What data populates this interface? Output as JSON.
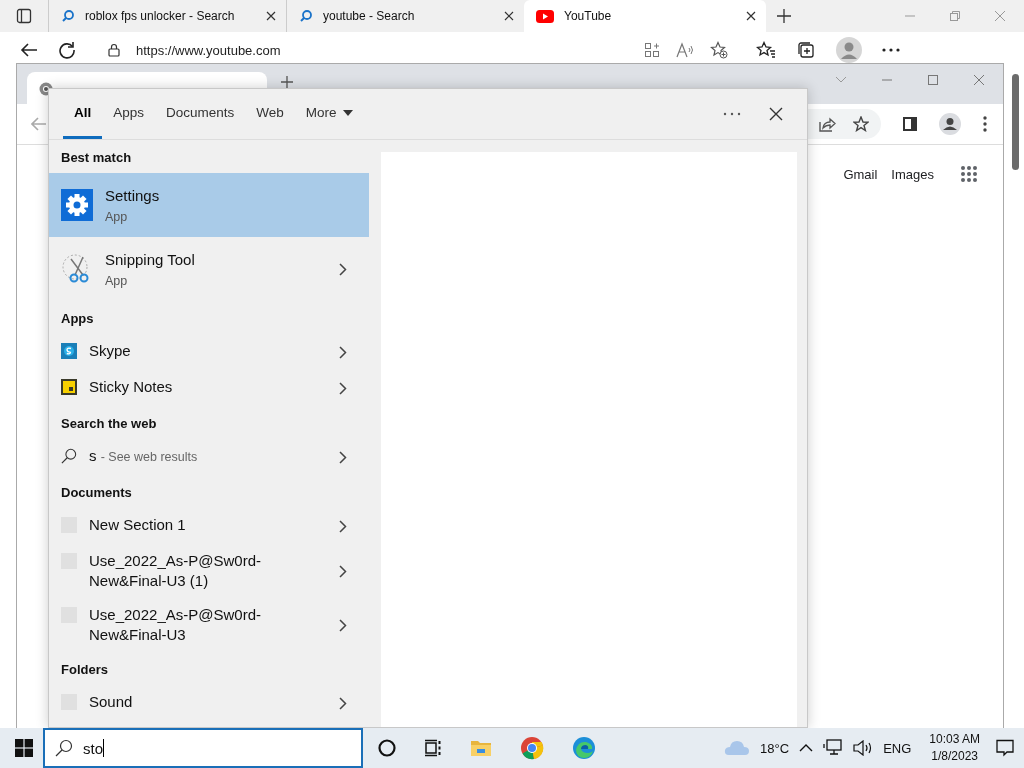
{
  "edge": {
    "tabs": [
      {
        "title": "roblox fps unlocker - Search",
        "kind": "search",
        "selected": false
      },
      {
        "title": "youtube - Search",
        "kind": "search",
        "selected": false
      },
      {
        "title": "YouTube",
        "kind": "youtube",
        "selected": true
      }
    ],
    "address": "https://www.youtube.com"
  },
  "chrome": {
    "links": [
      "Gmail",
      "Images"
    ]
  },
  "search": {
    "tabs": [
      {
        "label": "All",
        "selected": true
      },
      {
        "label": "Apps",
        "selected": false
      },
      {
        "label": "Documents",
        "selected": false
      },
      {
        "label": "Web",
        "selected": false
      },
      {
        "label": "More",
        "selected": false
      }
    ],
    "groups": [
      {
        "heading": "Best match",
        "items": [
          {
            "kind": "settings",
            "title": "Settings",
            "subtitle": "App",
            "selected": true
          },
          {
            "kind": "snipping",
            "title": "Snipping Tool",
            "subtitle": "App",
            "selected": false
          }
        ]
      },
      {
        "heading": "Apps",
        "items": [
          {
            "kind": "skype",
            "title": "Skype",
            "selected": false
          },
          {
            "kind": "sticky",
            "title": "Sticky Notes",
            "selected": false
          }
        ]
      },
      {
        "heading": "Search the web",
        "items": [
          {
            "kind": "web",
            "title": "s",
            "subtitle": "- See web results",
            "selected": false
          }
        ]
      },
      {
        "heading": "Documents",
        "items": [
          {
            "kind": "file",
            "title": "New Section 1",
            "selected": false
          },
          {
            "kind": "file",
            "title": "Use_2022_As-P@Sw0rd-New&Final-U3 (1)",
            "selected": false
          },
          {
            "kind": "file",
            "title": "Use_2022_As-P@Sw0rd-New&Final-U3",
            "selected": false
          }
        ]
      },
      {
        "heading": "Folders",
        "items": [
          {
            "kind": "file",
            "title": "Sound",
            "selected": false
          }
        ]
      }
    ],
    "query": "sto"
  },
  "taskbar": {
    "temperature": "18°C",
    "language": "ENG",
    "time": "10:03 AM",
    "date": "1/8/2023"
  }
}
